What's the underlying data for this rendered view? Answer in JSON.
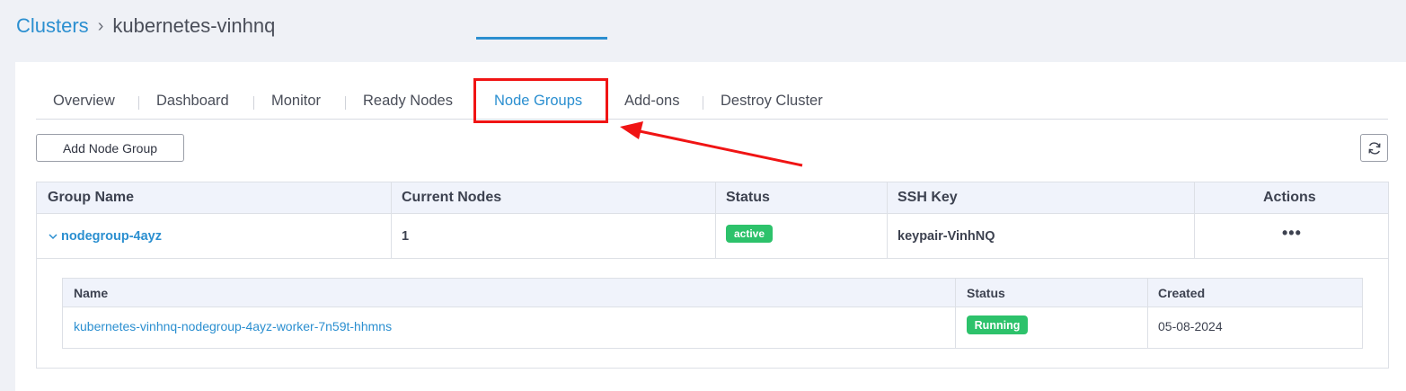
{
  "breadcrumb": {
    "root": "Clusters",
    "separator": "›",
    "current": "kubernetes-vinhnq"
  },
  "tabs": [
    {
      "label": "Overview"
    },
    {
      "label": "Dashboard"
    },
    {
      "label": "Monitor"
    },
    {
      "label": "Ready Nodes"
    },
    {
      "label": "Node Groups",
      "active": true
    },
    {
      "label": "Add-ons"
    },
    {
      "label": "Destroy Cluster"
    }
  ],
  "toolbar": {
    "add_label": "Add Node Group",
    "refresh_icon": "refresh-icon"
  },
  "table": {
    "headers": [
      "Group Name",
      "Current Nodes",
      "Status",
      "SSH Key",
      "Actions"
    ],
    "rows": [
      {
        "group_name": "nodegroup-4ayz",
        "current_nodes": "1",
        "status": "active",
        "ssh_key": "keypair-VinhNQ",
        "actions": "•••"
      }
    ]
  },
  "subtable": {
    "headers": [
      "Name",
      "Status",
      "Created"
    ],
    "rows": [
      {
        "name": "kubernetes-vinhnq-nodegroup-4ayz-worker-7n59t-hhmns",
        "status": "Running",
        "created": "05-08-2024"
      }
    ]
  },
  "colors": {
    "accent": "#2b8fd0",
    "success": "#2dc26b",
    "annotation": "#f01414"
  }
}
